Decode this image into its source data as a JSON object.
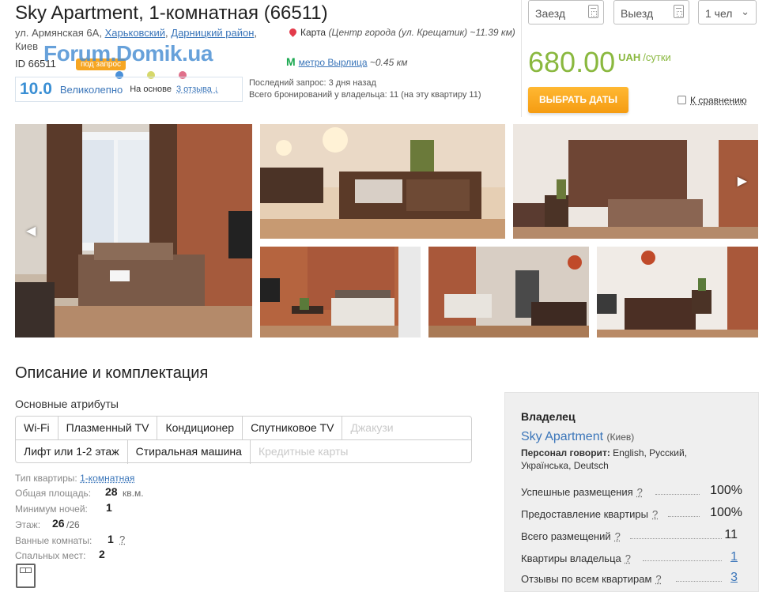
{
  "header": {
    "title": "Sky Apartment, 1-комнатная (66511)",
    "street": "ул. Армянская 6А,",
    "district1": "Харьковский",
    "district2": "Дарницкий район",
    "city": "Киев",
    "id_label": "ID 66511",
    "watermark": "Forum.Domik.ua",
    "badge": "под запрос",
    "map_label": "Карта",
    "map_note": "(Центр города (ул. Крещатик) ~11.39 км)",
    "metro_name": "метро Вырлица",
    "metro_dist": "~0.45 км",
    "last_request": "Последний запрос: 3 дня назад",
    "total_bookings": "Всего бронирований у владельца: 11 (на эту квартиру 11)"
  },
  "rating": {
    "score": "10.0",
    "word": "Великолепно",
    "basis": "На основе",
    "reviews": "3 отзыва ↓"
  },
  "booking": {
    "checkin_placeholder": "Заезд",
    "checkout_placeholder": "Выезд",
    "guests": "1 чел",
    "price": "680.00",
    "currency": "UAH",
    "per": "/сутки",
    "choose_button": "ВЫБРАТЬ ДАТЫ",
    "compare_label": "К сравнению"
  },
  "description": {
    "title": "Описание и комплектация",
    "attributes_title": "Основные атрибуты",
    "row1": [
      "Wi-Fi",
      "Плазменный TV",
      "Кондиционер",
      "Спутниковое TV",
      "Джакузи"
    ],
    "row2": [
      "Лифт или 1-2 этаж",
      "Стиральная машина",
      "Кредитные карты"
    ],
    "type_label": "Тип квартиры:",
    "type_value": "1-комнатная",
    "area_label": "Общая площадь:",
    "area_value": "28",
    "area_unit": "кв.м.",
    "min_nights_label": "Минимум ночей:",
    "min_nights_value": "1",
    "floor_label": "Этаж:",
    "floor_value": "26",
    "floor_total": "/26",
    "bathrooms_label": "Ванные комнаты:",
    "bathrooms_value": "1",
    "bathrooms_q": "?",
    "beds_label": "Спальных мест:",
    "beds_value": "2"
  },
  "owner": {
    "heading": "Владелец",
    "name": "Sky Apartment",
    "city": "(Киев)",
    "languages_label": "Персонал говорит:",
    "languages": "English, Русский, Українська, Deutsch",
    "stats": [
      {
        "label": "Успешные размещения",
        "q": "?",
        "value": "100%"
      },
      {
        "label": "Предоставление квартиры",
        "q": "?",
        "value": "100%"
      },
      {
        "label": "Всего размещений",
        "q": "?",
        "value": "11"
      },
      {
        "label": "Квартиры владельца",
        "q": "?",
        "value": "1"
      },
      {
        "label": "Отзывы по всем квартирам",
        "q": "?",
        "value": "3"
      }
    ]
  },
  "colors": {
    "price_green": "#8ab83f",
    "button_orange": "#f59c12",
    "link_blue": "#3a75b9",
    "metro_green": "#1aa84f"
  }
}
